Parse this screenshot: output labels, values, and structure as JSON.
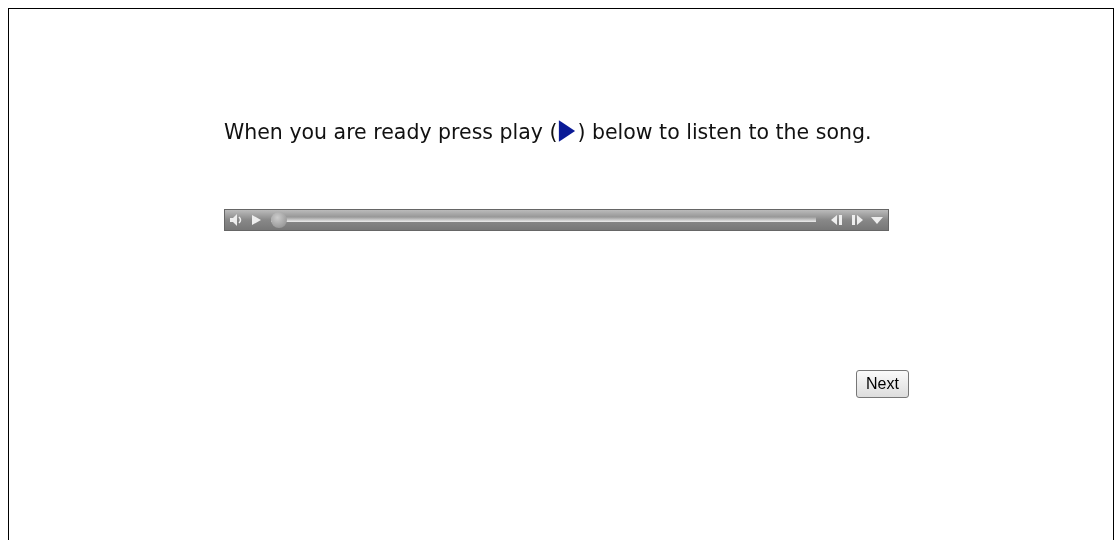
{
  "instruction": {
    "before": "When you are ready press play (",
    "after": ") below to listen to the song."
  },
  "player": {
    "level": 0
  },
  "buttons": [
    "Next"
  ]
}
